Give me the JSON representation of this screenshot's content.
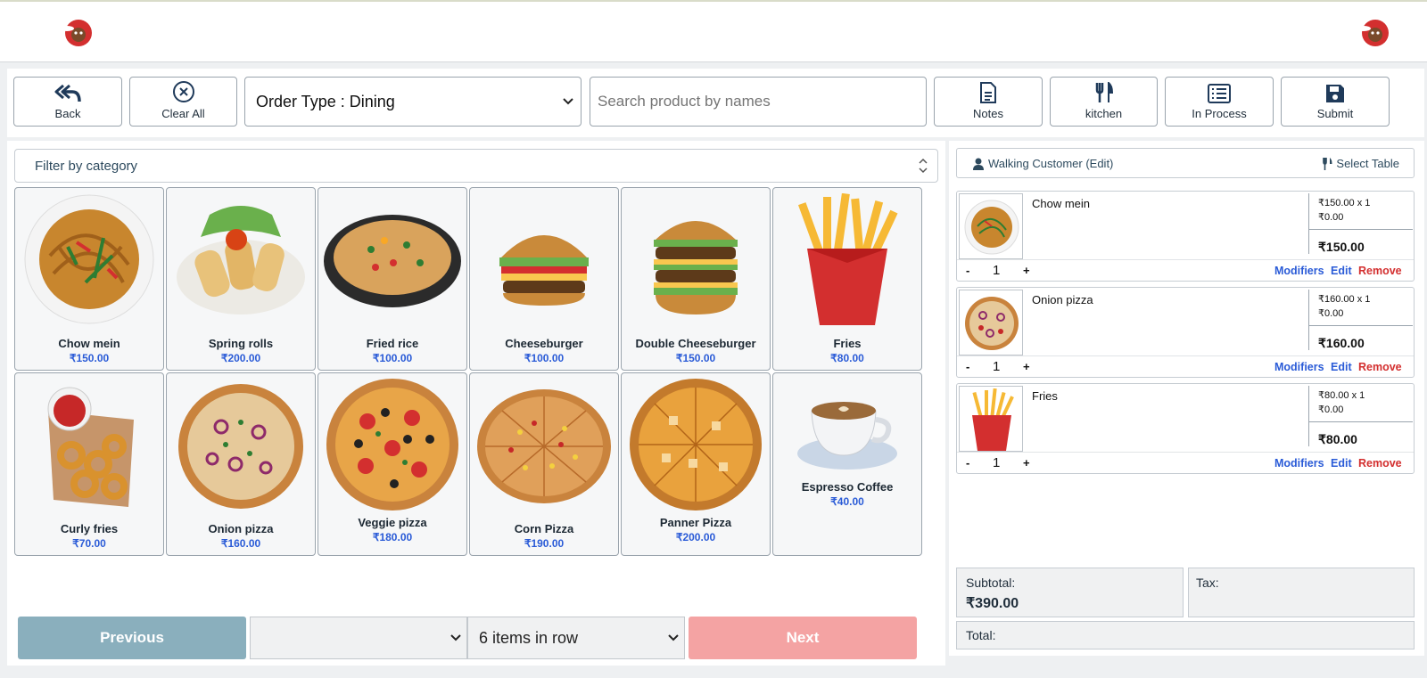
{
  "header": {
    "logo_left": "chef-mascot-logo",
    "logo_right": "chef-mascot-logo"
  },
  "toolbar": {
    "back_label": "Back",
    "clear_label": "Clear All",
    "order_type": "Order Type : Dining",
    "search_placeholder": "Search product by names",
    "notes_label": "Notes",
    "kitchen_label": "kitchen",
    "inprocess_label": "In Process",
    "submit_label": "Submit"
  },
  "catalog": {
    "filter_label": "Filter by category",
    "products": [
      {
        "name": "Chow mein",
        "price": "₹150.00"
      },
      {
        "name": "Spring rolls",
        "price": "₹200.00"
      },
      {
        "name": "Fried rice",
        "price": "₹100.00"
      },
      {
        "name": "Cheeseburger",
        "price": "₹100.00"
      },
      {
        "name": "Double Cheeseburger",
        "price": "₹150.00"
      },
      {
        "name": "Fries",
        "price": "₹80.00"
      },
      {
        "name": "Curly fries",
        "price": "₹70.00"
      },
      {
        "name": "Onion pizza",
        "price": "₹160.00"
      },
      {
        "name": "Veggie pizza",
        "price": "₹180.00"
      },
      {
        "name": "Corn Pizza",
        "price": "₹190.00"
      },
      {
        "name": "Panner Pizza",
        "price": "₹200.00"
      },
      {
        "name": "Espresso Coffee",
        "price": "₹40.00"
      }
    ]
  },
  "pager": {
    "previous_label": "Previous",
    "page_value": "",
    "per_row": "6 items in row",
    "next_label": "Next"
  },
  "order": {
    "customer_label": "Walking Customer (Edit)",
    "table_label": "Select Table",
    "items": [
      {
        "name": "Chow mein",
        "unit_line": "₹150.00 x 1",
        "discount_line": "₹0.00",
        "total": "₹150.00",
        "qty": "1"
      },
      {
        "name": "Onion pizza",
        "unit_line": "₹160.00 x 1",
        "discount_line": "₹0.00",
        "total": "₹160.00",
        "qty": "1"
      },
      {
        "name": "Fries",
        "unit_line": "₹80.00 x 1",
        "discount_line": "₹0.00",
        "total": "₹80.00",
        "qty": "1"
      }
    ],
    "minus": "-",
    "plus": "+",
    "modifiers_label": "Modifiers",
    "edit_label": "Edit",
    "remove_label": "Remove",
    "subtotal_label": "Subtotal:",
    "subtotal_value": "₹390.00",
    "tax_label": "Tax:",
    "total_label": "Total:"
  },
  "colors": {
    "price": "#2a5bd7",
    "remove": "#d32f2f",
    "previous_bg": "#8aafbd",
    "next_bg": "#f4a3a3"
  }
}
